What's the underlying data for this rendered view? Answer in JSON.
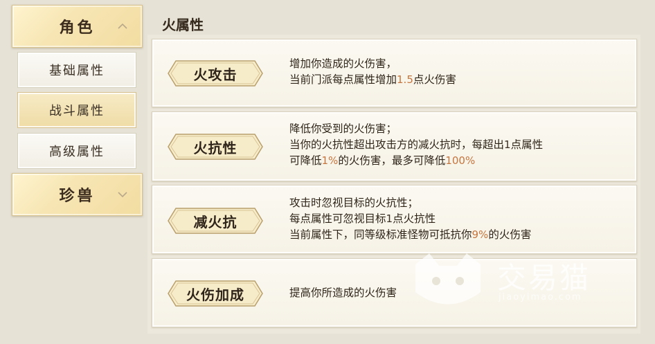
{
  "nav": {
    "group_role": "角色",
    "items": [
      {
        "label": "基础属性"
      },
      {
        "label": "战斗属性"
      },
      {
        "label": "高级属性"
      }
    ],
    "group_pet": "珍兽"
  },
  "panel": {
    "title": "火属性",
    "cards": [
      {
        "name": "火攻击",
        "lines": [
          {
            "parts": [
              "增加你造成的火伤害，"
            ]
          },
          {
            "parts": [
              "当前门派每点属性增加",
              "1.5",
              "点火伤害"
            ]
          }
        ]
      },
      {
        "name": "火抗性",
        "lines": [
          {
            "parts": [
              "降低你受到的火伤害；"
            ]
          },
          {
            "parts": [
              "当你的火抗性超出攻击方的减火抗时，每超出",
              "1",
              "点属性"
            ]
          },
          {
            "parts": [
              "可降低",
              "1%",
              "的火伤害，最多可降低",
              "100%"
            ]
          }
        ]
      },
      {
        "name": "减火抗",
        "lines": [
          {
            "parts": [
              "攻击时忽视目标的火抗性；"
            ]
          },
          {
            "parts": [
              "每点属性可忽视目标",
              "1",
              "点火抗性"
            ]
          },
          {
            "parts": [
              "当前属性下，同等级标准怪物可抵抗你",
              "9%",
              "的火伤害"
            ]
          }
        ]
      },
      {
        "name": "火伤加成",
        "lines": [
          {
            "parts": [
              "提高你所造成的火伤害"
            ]
          }
        ]
      }
    ]
  },
  "watermark": {
    "text": "交易猫",
    "sub": "jiaoyimao.com"
  },
  "colors": {
    "highlight": "#c5763e",
    "active_tab": "#efdca6"
  }
}
